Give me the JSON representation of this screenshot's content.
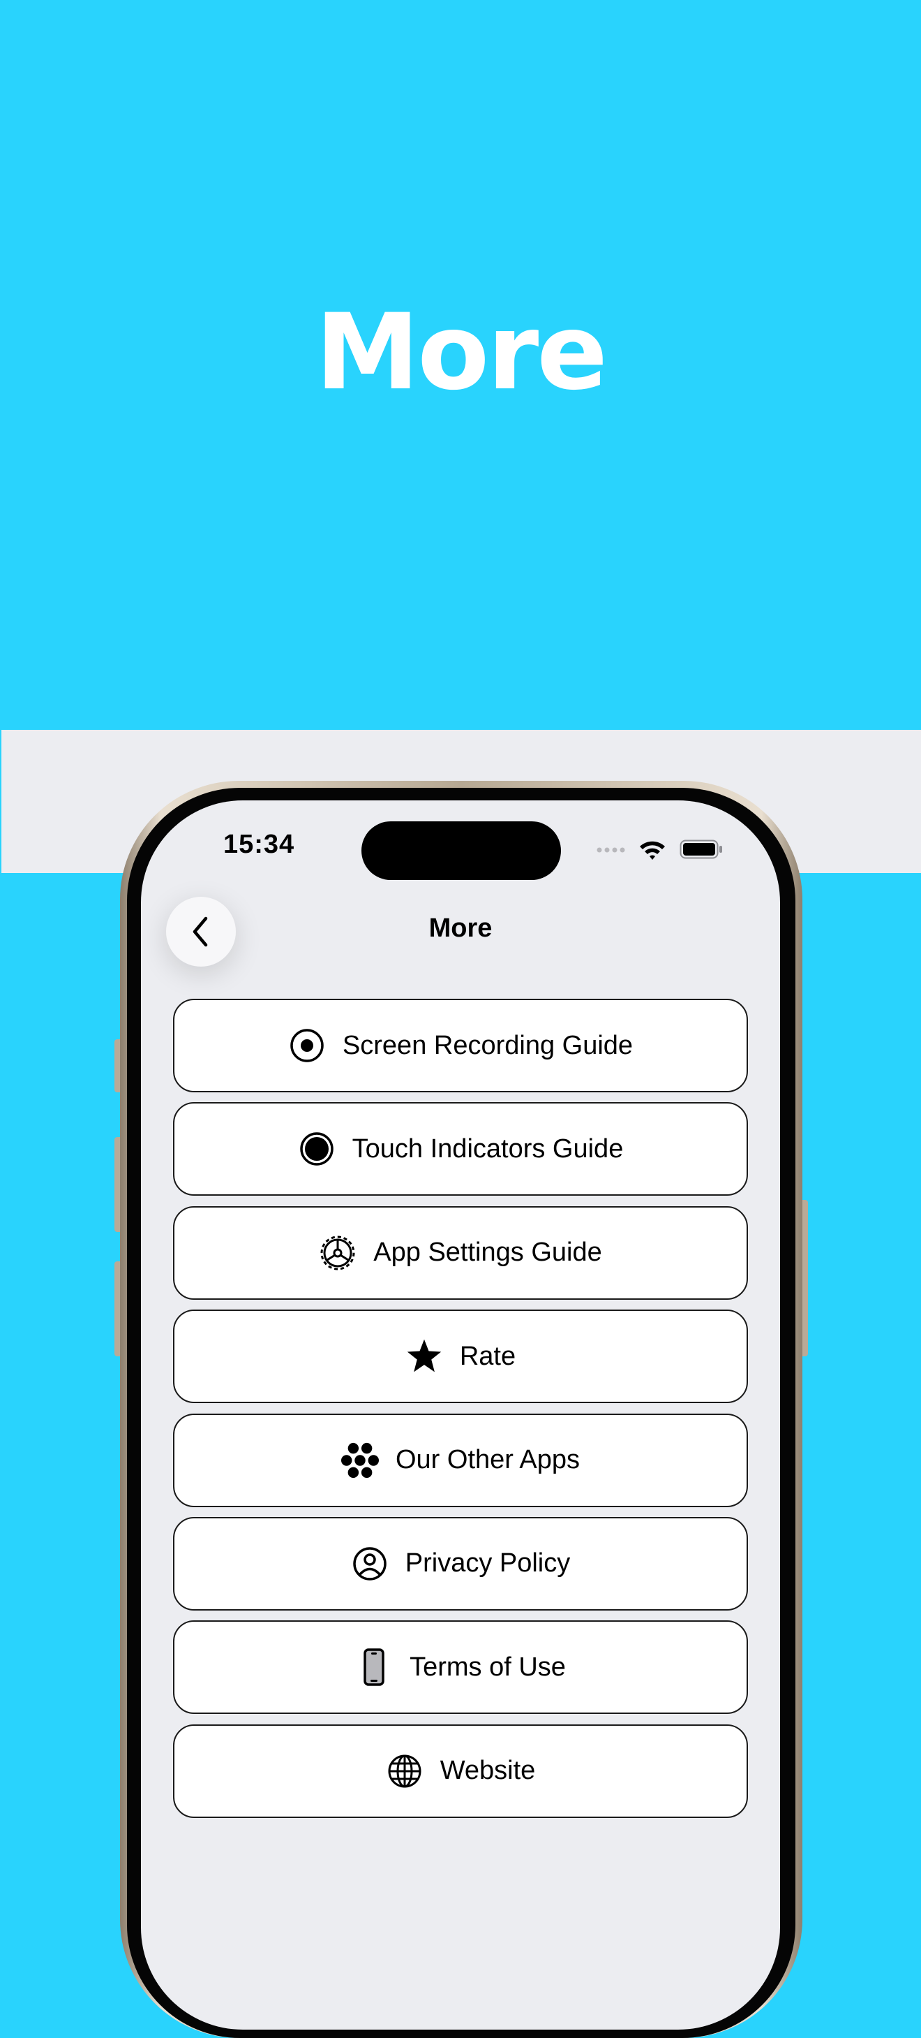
{
  "hero": {
    "title": "More"
  },
  "status_bar": {
    "time": "15:34"
  },
  "nav": {
    "title": "More",
    "back_icon": "chevron-left-icon"
  },
  "menu": {
    "items": [
      {
        "label": "Screen Recording Guide",
        "icon": "record-circle-icon"
      },
      {
        "label": "Touch Indicators Guide",
        "icon": "filled-circle-icon"
      },
      {
        "label": "App Settings Guide",
        "icon": "gear-icon"
      },
      {
        "label": "Rate",
        "icon": "star-icon"
      },
      {
        "label": "Our Other Apps",
        "icon": "app-cluster-icon"
      },
      {
        "label": "Privacy Policy",
        "icon": "person-circle-icon"
      },
      {
        "label": "Terms of Use",
        "icon": "phone-icon"
      },
      {
        "label": "Website",
        "icon": "globe-icon"
      }
    ]
  },
  "colors": {
    "background": "#29D3FD",
    "band": "#ECEDF1",
    "screen": "#ECEDF1",
    "button_border": "#1a1a1a"
  }
}
